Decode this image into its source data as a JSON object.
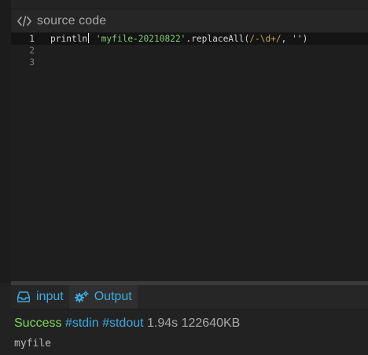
{
  "source_panel": {
    "title": "source code",
    "icon": "code-icon"
  },
  "editor": {
    "line_numbers": [
      "1",
      "2",
      "3"
    ],
    "line1": {
      "prefix": "println",
      "string": "'myfile-20210822'",
      "method": ".replaceAll(",
      "regex": "/-\\d+/",
      "rest": ", '')"
    }
  },
  "tabs": [
    {
      "label": "input",
      "icon": "inbox-icon"
    },
    {
      "label": "Output",
      "icon": "gears-icon"
    }
  ],
  "output": {
    "status": "Success",
    "tag_stdin": "#stdin",
    "tag_stdout": "#stdout",
    "time": "1.94s",
    "memory": "122640KB",
    "result": "myfile"
  },
  "colors": {
    "accent": "#3fa9e0",
    "success": "#7ed957",
    "string": "#7ec87e",
    "background": "#1e1e1e"
  }
}
